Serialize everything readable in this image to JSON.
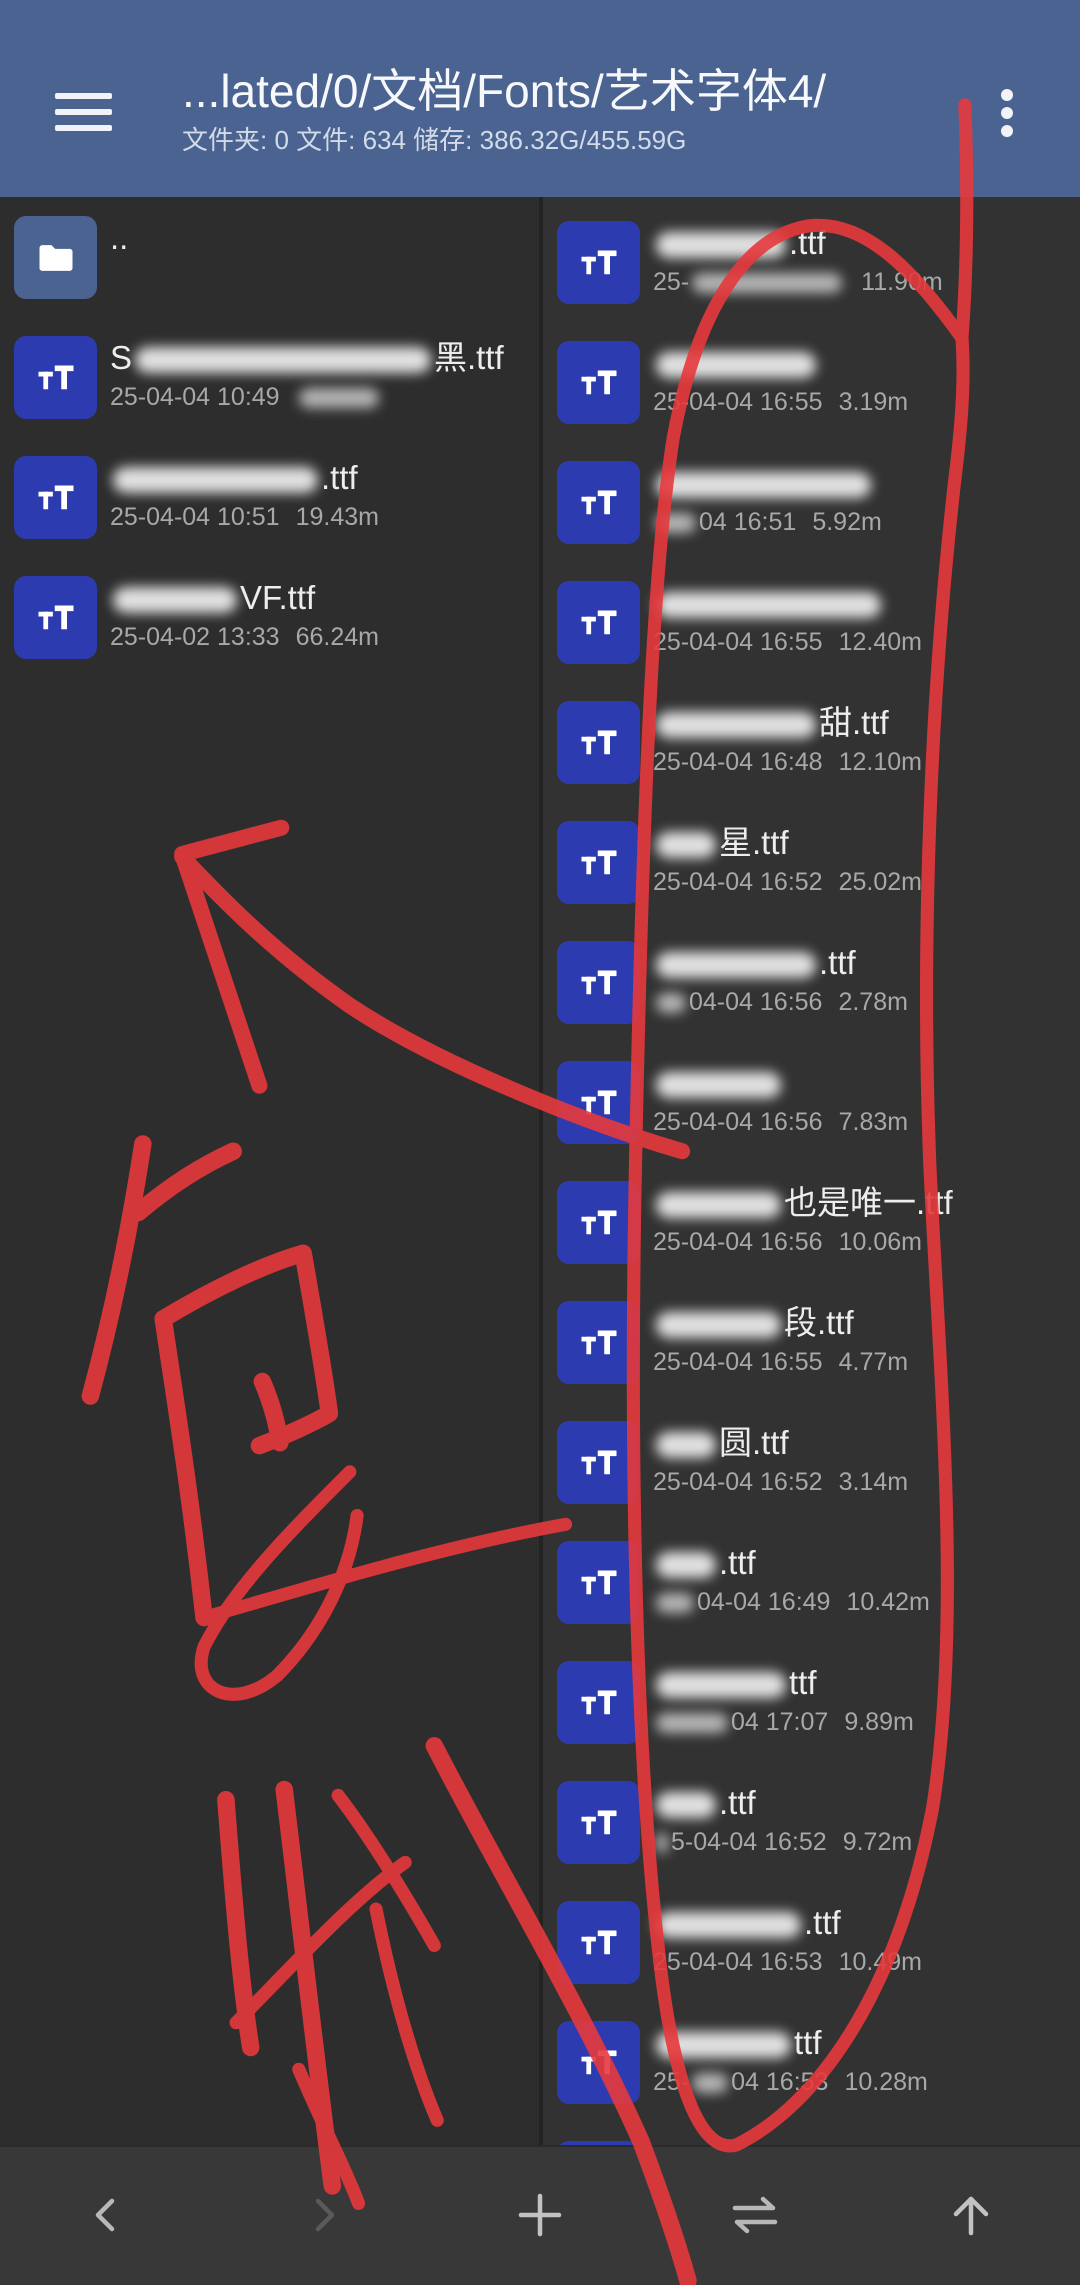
{
  "header": {
    "path_title": "...lated/0/文档/Fonts/艺术字体4/",
    "summary": "文件夹: 0 文件: 634 储存: 386.32G/455.59G",
    "menu_icon": "hamburger-menu-icon",
    "more_icon": "more-vertical-icon"
  },
  "theme": {
    "header_bg": "#4a6391",
    "font_icon_bg": "#2c3bb0",
    "folder_icon_bg": "#4a6391",
    "left_pane_bg": "#2d2d2d",
    "right_pane_bg": "#323232",
    "bottom_bar_bg": "#383838",
    "annotation_red": "#e6393c"
  },
  "left_pane": {
    "items": [
      {
        "icon": "folder-icon",
        "name_pre": "..",
        "name_post": ""
      },
      {
        "icon": "font-file-icon",
        "name_pre": "S",
        "name_post": "黑.ttf",
        "date_pre": "",
        "date": "25-04-04 10:49",
        "size": ""
      },
      {
        "icon": "font-file-icon",
        "name_pre": "",
        "name_post": ".ttf",
        "date_pre": "",
        "date": "25-04-04 10:51",
        "size": "19.43m"
      },
      {
        "icon": "font-file-icon",
        "name_pre": "",
        "name_post": "VF.ttf",
        "date_pre": "",
        "date": "25-04-02 13:33",
        "size": "66.24m"
      }
    ]
  },
  "right_pane": {
    "items": [
      {
        "icon": "font-file-icon",
        "name_pre": "",
        "name_post": ".ttf",
        "date_pre": "25-",
        "date": "",
        "size": "11.90m"
      },
      {
        "icon": "font-file-icon",
        "name_pre": "",
        "name_post": "",
        "date_pre": "",
        "date": "25-04-04 16:55",
        "size": "3.19m"
      },
      {
        "icon": "font-file-icon",
        "name_pre": "",
        "name_post": "",
        "date_pre": "",
        "date": "04 16:51",
        "size": "5.92m"
      },
      {
        "icon": "font-file-icon",
        "name_pre": "",
        "name_post": "",
        "date_pre": "",
        "date": "25-04-04 16:55",
        "size": "12.40m"
      },
      {
        "icon": "font-file-icon",
        "name_pre": "",
        "name_post": "甜.ttf",
        "date_pre": "",
        "date": "25-04-04 16:48",
        "size": "12.10m"
      },
      {
        "icon": "font-file-icon",
        "name_pre": "",
        "name_post": "星.ttf",
        "date_pre": "",
        "date": "25-04-04 16:52",
        "size": "25.02m"
      },
      {
        "icon": "font-file-icon",
        "name_pre": "",
        "name_post": ".ttf",
        "date_pre": "",
        "date": "04-04 16:56",
        "size": "2.78m"
      },
      {
        "icon": "font-file-icon",
        "name_pre": "",
        "name_post": "",
        "date_pre": "",
        "date": "25-04-04 16:56",
        "size": "7.83m"
      },
      {
        "icon": "font-file-icon",
        "name_pre": "",
        "name_post": "也是唯一.ttf",
        "date_pre": "",
        "date": "25-04-04 16:56",
        "size": "10.06m"
      },
      {
        "icon": "font-file-icon",
        "name_pre": "",
        "name_post": "段.ttf",
        "date_pre": "",
        "date": "25-04-04 16:55",
        "size": "4.77m"
      },
      {
        "icon": "font-file-icon",
        "name_pre": "",
        "name_post": "圆.ttf",
        "date_pre": "",
        "date": "25-04-04 16:52",
        "size": "3.14m"
      },
      {
        "icon": "font-file-icon",
        "name_pre": "",
        "name_post": ".ttf",
        "date_pre": "",
        "date": "04-04 16:49",
        "size": "10.42m"
      },
      {
        "icon": "font-file-icon",
        "name_pre": "",
        "name_post": "ttf",
        "date_pre": "",
        "date": "04 17:07",
        "size": "9.89m"
      },
      {
        "icon": "font-file-icon",
        "name_pre": "",
        "name_post": ".ttf",
        "date_pre": "",
        "date": "5-04-04 16:52",
        "size": "9.72m"
      },
      {
        "icon": "font-file-icon",
        "name_pre": "",
        "name_post": ".ttf",
        "date_pre": "",
        "date": "25-04-04 16:53",
        "size": "10.49m"
      },
      {
        "icon": "font-file-icon",
        "name_pre": "",
        "name_post": "ttf",
        "date_pre": "25-",
        "date": "04 16:53",
        "size": "10.28m"
      }
    ]
  },
  "bottom_bar": {
    "items": [
      {
        "icon": "back-chevron-icon",
        "enabled": true
      },
      {
        "icon": "forward-chevron-icon",
        "enabled": false
      },
      {
        "icon": "plus-icon",
        "enabled": true
      },
      {
        "icon": "swap-icon",
        "enabled": true
      },
      {
        "icon": "arrow-up-icon",
        "enabled": true
      }
    ]
  }
}
